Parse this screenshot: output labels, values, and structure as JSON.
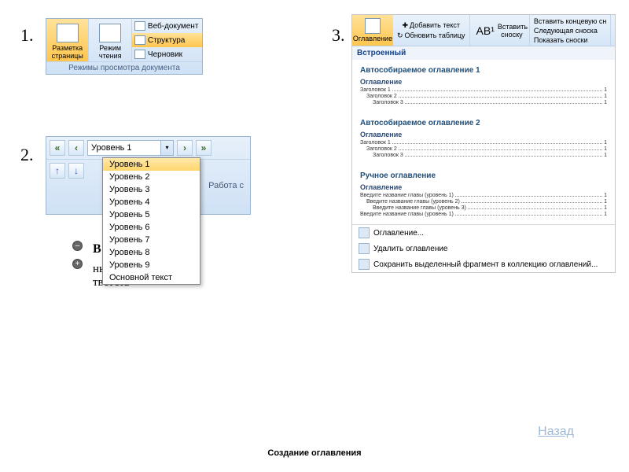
{
  "numbers": {
    "n1": "1.",
    "n2": "2.",
    "n3": "3."
  },
  "panel1": {
    "page_layout": "Разметка страницы",
    "reading": "Режим чтения",
    "web": "Веб-документ",
    "outline": "Структура",
    "draft": "Черновик",
    "title": "Режимы просмотра документа"
  },
  "panel2": {
    "combo_label": "Уровень 1",
    "status": "Работа с",
    "levels": [
      "Уровень 1",
      "Уровень 2",
      "Уровень 3",
      "Уровень 4",
      "Уровень 5",
      "Уровень 6",
      "Уровень 7",
      "Уровень 8",
      "Уровень 9",
      "Основной текст"
    ]
  },
  "hidden_frag1": "ных·уби",
  "hidden_frag2": "тветств",
  "panel3": {
    "ribbon": {
      "big": "Оглавление",
      "add_text": "Добавить текст",
      "update": "Обновить таблицу",
      "insert_footnote": "Вставить сноску",
      "ab": "AB¹",
      "insert_end": "Вставить концевую сн",
      "next_note": "Следующая сноска",
      "show_notes": "Показать сноски"
    },
    "section": "Встроенный",
    "cards": [
      {
        "title": "Автособираемое оглавление 1",
        "header": "Оглавление",
        "lines": [
          {
            "lbl": "Заголовок 1",
            "pg": "1",
            "cls": ""
          },
          {
            "lbl": "Заголовок 2",
            "pg": "1",
            "cls": "ind1"
          },
          {
            "lbl": "Заголовок 3",
            "pg": "1",
            "cls": "ind2"
          }
        ]
      },
      {
        "title": "Автособираемое оглавление 2",
        "header": "Оглавление",
        "lines": [
          {
            "lbl": "Заголовок 1",
            "pg": "1",
            "cls": ""
          },
          {
            "lbl": "Заголовок 2",
            "pg": "1",
            "cls": "ind1"
          },
          {
            "lbl": "Заголовок 3",
            "pg": "1",
            "cls": "ind2"
          }
        ]
      },
      {
        "title": "Ручное оглавление",
        "header": "Оглавление",
        "lines": [
          {
            "lbl": "Введите название главы (уровень 1)",
            "pg": "1",
            "cls": ""
          },
          {
            "lbl": "Введите название главы (уровень 2)",
            "pg": "1",
            "cls": "ind1"
          },
          {
            "lbl": "Введите название главы (уровень 3)",
            "pg": "1",
            "cls": "ind2"
          },
          {
            "lbl": "Введите название главы (уровень 1)",
            "pg": "1",
            "cls": ""
          }
        ]
      }
    ],
    "footer": {
      "toc": "Оглавление...",
      "remove": "Удалить оглавление",
      "save": "Сохранить выделенный фрагмент в коллекцию оглавлений..."
    }
  },
  "back": "Назад",
  "page_title": "Создание оглавления"
}
